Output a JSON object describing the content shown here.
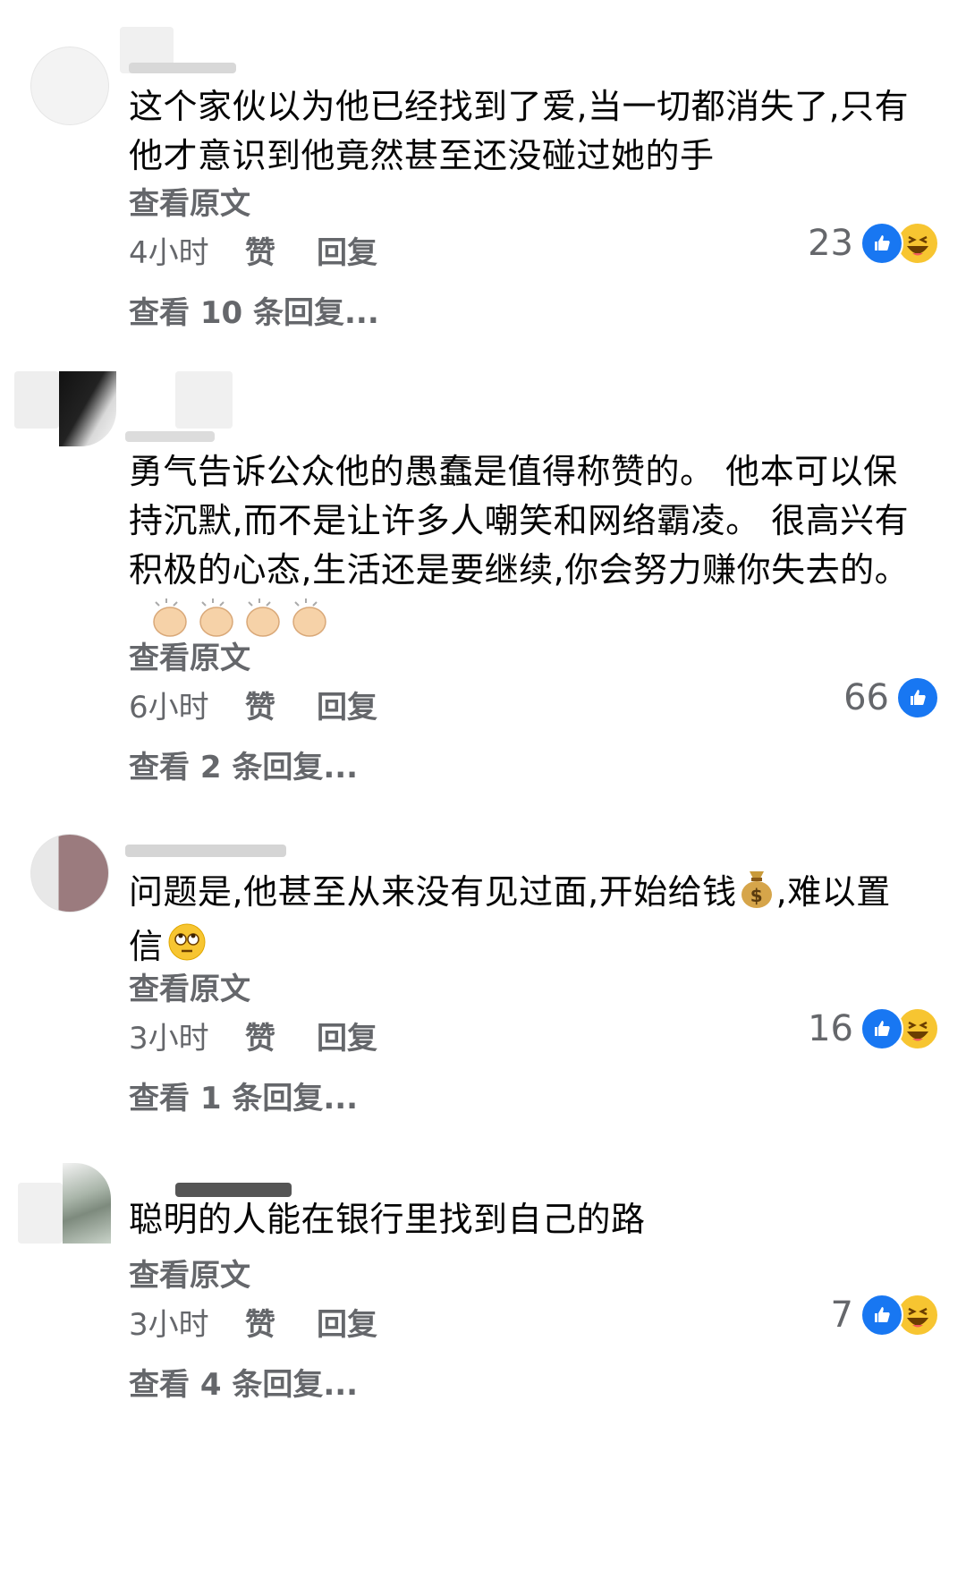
{
  "common": {
    "see_original": "查看原文",
    "like": "赞",
    "reply": "回复"
  },
  "comments": [
    {
      "text": "这个家伙以为他已经找到了爱,当一切都消失了,只有他才意识到他竟然甚至还没碰过她的手",
      "time": "4小时",
      "reaction_count": "23",
      "view_replies": "查看 10 条回复..."
    },
    {
      "text": "勇气告诉公众他的愚蠢是值得称赞的。 他本可以保持沉默,而不是让许多人嘲笑和网络霸凌。 很高兴有积极的心态,生活还是要继续,你会努力赚你失去的。",
      "time": "6小时",
      "reaction_count": "66",
      "view_replies": "查看 2 条回复..."
    },
    {
      "text_part1": "问题是,他甚至从来没有见过面,开始给钱",
      "text_part2": ",难以置信",
      "time": "3小时",
      "reaction_count": "16",
      "view_replies": "查看 1 条回复..."
    },
    {
      "text": "聪明的人能在银行里找到自己的路",
      "time": "3小时",
      "reaction_count": "7",
      "view_replies": "查看 4 条回复..."
    }
  ],
  "colors": {
    "like_blue": "#1877f2",
    "haha_yellow": "#f7c531",
    "muted": "#65676b"
  }
}
